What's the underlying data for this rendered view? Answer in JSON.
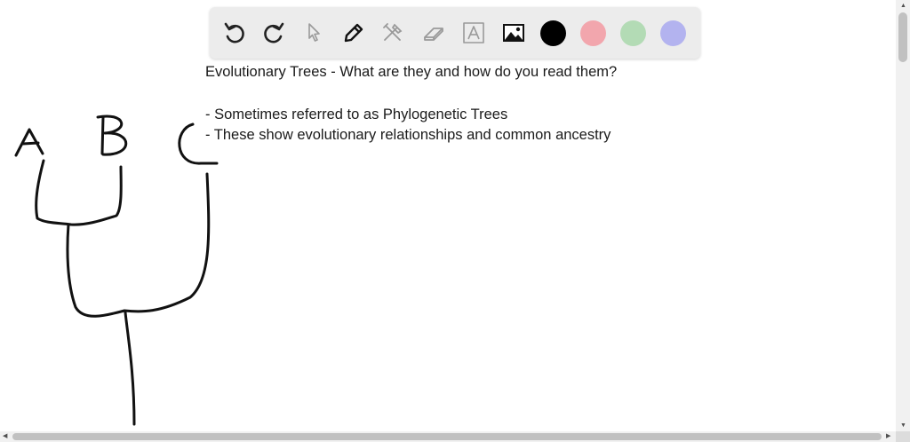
{
  "toolbar": {
    "tools": [
      "undo-icon",
      "redo-icon",
      "select-pointer-icon",
      "pen-icon",
      "tools-icon",
      "eraser-icon",
      "text-icon",
      "image-icon"
    ],
    "colors": [
      "#000000",
      "#f2a6ad",
      "#b3dbb5",
      "#b3b3ef"
    ],
    "selected_color": "#000000"
  },
  "notes": {
    "title": "Evolutionary Trees - What are they and how do you read them?",
    "bullet1": " - Sometimes referred to as Phylogenetic Trees",
    "bullet2": "- These show evolutionary relationships and common ancestry"
  },
  "drawing": {
    "tree_labels": [
      "A",
      "B",
      "C"
    ]
  }
}
